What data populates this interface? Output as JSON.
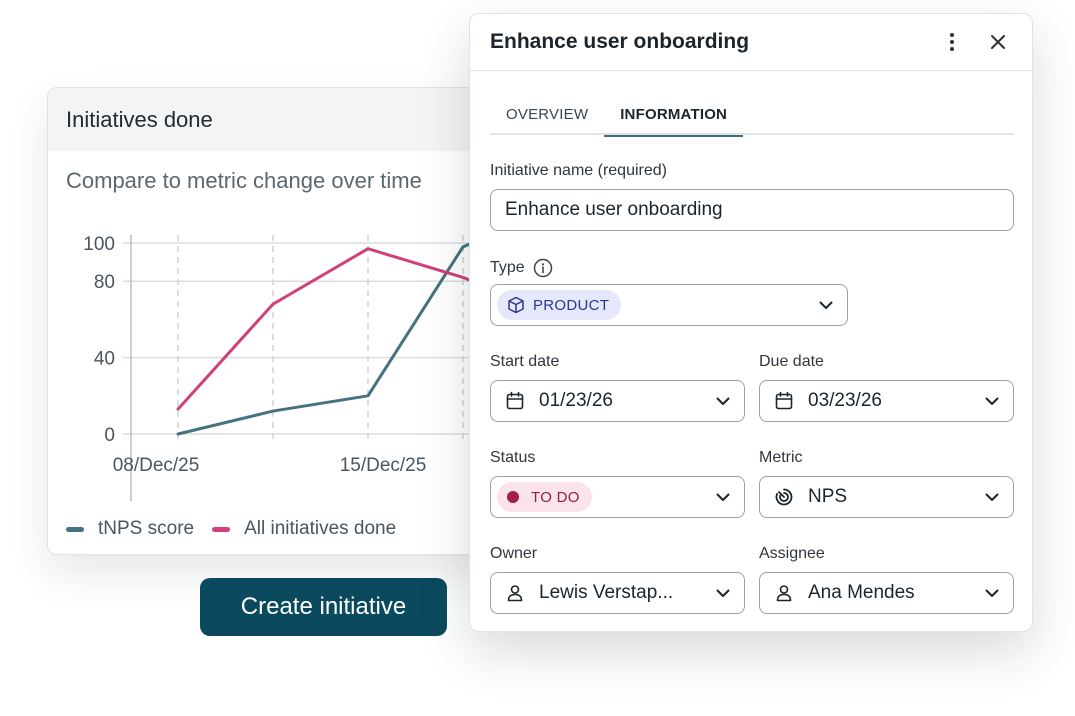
{
  "card": {
    "title": "Initiatives done",
    "subtitle": "Compare to metric change over time"
  },
  "chart_data": {
    "type": "line",
    "y_ticks": [
      0,
      40,
      80,
      100
    ],
    "ylim": [
      0,
      100
    ],
    "x_tick_labels": [
      "08/Dec/25",
      "15/Dec/25"
    ],
    "x": [
      0,
      1,
      2,
      3,
      3.1
    ],
    "series": [
      {
        "name": "tNPS score",
        "color": "#44737f",
        "values": [
          0,
          12,
          20,
          98,
          100
        ]
      },
      {
        "name": "All initiatives done",
        "color": "#d0407a",
        "values": [
          13,
          68,
          97,
          82,
          80
        ]
      }
    ],
    "grid": true
  },
  "create_button": {
    "label": "Create initiative"
  },
  "panel": {
    "title": "Enhance user onboarding",
    "tabs": [
      {
        "label": "OVERVIEW",
        "active": false
      },
      {
        "label": "INFORMATION",
        "active": true
      }
    ],
    "fields": {
      "name": {
        "label": "Initiative name (required)",
        "value": "Enhance user onboarding"
      },
      "type": {
        "label": "Type",
        "value": "PRODUCT",
        "icon": "cube-icon"
      },
      "start_date": {
        "label": "Start date",
        "value": "01/23/26",
        "icon": "calendar-icon"
      },
      "due_date": {
        "label": "Due date",
        "value": "03/23/26",
        "icon": "calendar-icon"
      },
      "status": {
        "label": "Status",
        "value": "TO DO"
      },
      "metric": {
        "label": "Metric",
        "value": "NPS",
        "icon": "gauge-icon"
      },
      "owner": {
        "label": "Owner",
        "value": "Lewis Verstap...",
        "icon": "user-icon"
      },
      "assignee": {
        "label": "Assignee",
        "value": "Ana Mendes",
        "icon": "user-icon"
      }
    }
  }
}
